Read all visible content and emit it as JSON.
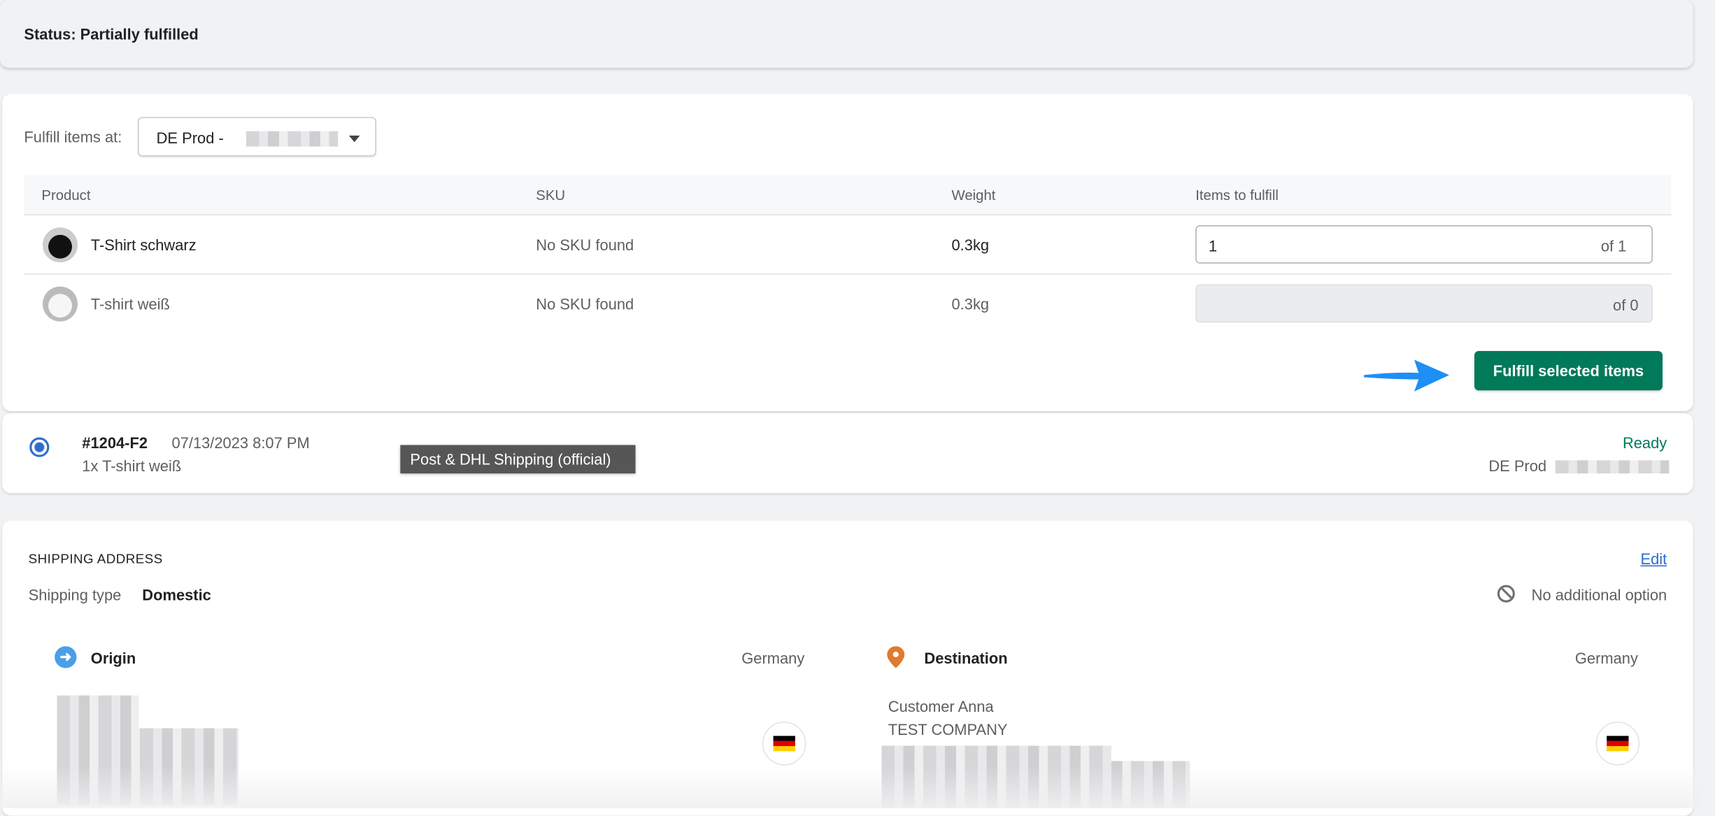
{
  "status": {
    "text": "Status: Partially fulfilled"
  },
  "fulfill": {
    "location_label": "Fulfill items at:",
    "location_value": "DE Prod -",
    "columns": [
      "Product",
      "SKU",
      "Weight",
      "Items to fulfill"
    ],
    "rows": [
      {
        "product": "T-Shirt schwarz",
        "sku": "No SKU found",
        "weight": "0.3kg",
        "qty": "1",
        "of": "of 1",
        "disabled": false
      },
      {
        "product": "T-shirt weiß",
        "sku": "No SKU found",
        "weight": "0.3kg",
        "qty": "",
        "of": "of 0",
        "disabled": true
      }
    ],
    "submit_label": "Fulfill selected items",
    "button_color": "#017a5a",
    "arrow_color": "#1e8ff5"
  },
  "fulfillment": {
    "id": "#1204-F2",
    "date": "07/13/2023 8:07 PM",
    "items": "1x T-shirt weiß",
    "tooltip": "Post & DHL Shipping (official)",
    "status": "Ready",
    "location": "DE Prod"
  },
  "shipping": {
    "title": "SHIPPING ADDRESS",
    "edit_label": "Edit",
    "type_label": "Shipping type",
    "type_value": "Domestic",
    "option": "No additional option",
    "origin": {
      "label": "Origin",
      "country": "Germany"
    },
    "destination": {
      "label": "Destination",
      "country": "Germany",
      "name": "Customer Anna",
      "company": "TEST COMPANY"
    }
  }
}
